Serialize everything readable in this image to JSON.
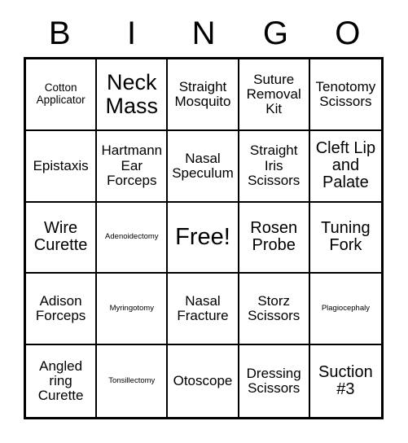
{
  "card": {
    "header_letters": [
      "B",
      "I",
      "N",
      "G",
      "O"
    ],
    "free_space_label": "Free!",
    "grid_color": "#000000",
    "background_color": "#ffffff",
    "rows": [
      [
        {
          "label": "Cotton Applicator",
          "size": "sm"
        },
        {
          "label": "Neck Mass",
          "size": "xl"
        },
        {
          "label": "Straight Mosquito",
          "size": "md"
        },
        {
          "label": "Suture Removal Kit",
          "size": "md"
        },
        {
          "label": "Tenotomy Scissors",
          "size": "md"
        }
      ],
      [
        {
          "label": "Epistaxis",
          "size": "md"
        },
        {
          "label": "Hartmann Ear Forceps",
          "size": "md"
        },
        {
          "label": "Nasal Speculum",
          "size": "md"
        },
        {
          "label": "Straight Iris Scissors",
          "size": "md"
        },
        {
          "label": "Cleft Lip and Palate",
          "size": "lg"
        }
      ],
      [
        {
          "label": "Wire Curette",
          "size": "lg"
        },
        {
          "label": "Adenoidectomy",
          "size": "xs"
        },
        {
          "label": "Free!",
          "size": "free"
        },
        {
          "label": "Rosen Probe",
          "size": "lg"
        },
        {
          "label": "Tuning Fork",
          "size": "lg"
        }
      ],
      [
        {
          "label": "Adison Forceps",
          "size": "md"
        },
        {
          "label": "Myringotomy",
          "size": "xs"
        },
        {
          "label": "Nasal Fracture",
          "size": "md"
        },
        {
          "label": "Storz Scissors",
          "size": "md"
        },
        {
          "label": "Plagiocephaly",
          "size": "xs"
        }
      ],
      [
        {
          "label": "Angled ring Curette",
          "size": "md"
        },
        {
          "label": "Tonsillectomy",
          "size": "xs"
        },
        {
          "label": "Otoscope",
          "size": "md"
        },
        {
          "label": "Dressing Scissors",
          "size": "md"
        },
        {
          "label": "Suction #3",
          "size": "lg"
        }
      ]
    ]
  }
}
